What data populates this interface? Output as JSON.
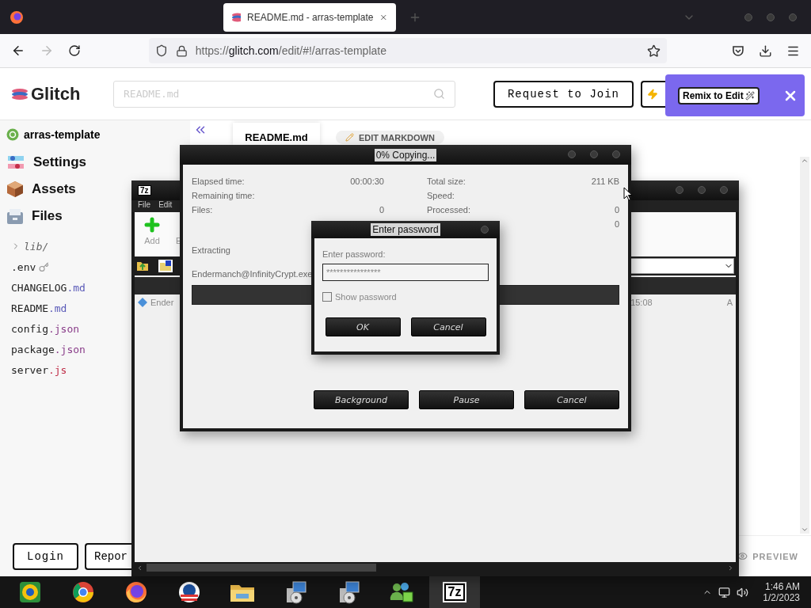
{
  "browser": {
    "tabs": [
      {
        "title": "README.md - arras-template",
        "selected": true
      }
    ],
    "url": {
      "scheme": "https://",
      "host": "glitch.com",
      "path": "/edit/#!/arras-template"
    }
  },
  "glitch": {
    "logo": "Glitch",
    "search": {
      "placeholder": "README.md"
    },
    "request_button": "Request to Join",
    "remix_button": "Remix to Edit"
  },
  "sidebar": {
    "project": "arras-template",
    "sections": [
      {
        "label": "Settings",
        "kind": "settings"
      },
      {
        "label": "Assets",
        "kind": "assets"
      },
      {
        "label": "Files",
        "kind": "files"
      }
    ],
    "files": [
      {
        "kind": "folder",
        "base": "lib/",
        "expanded": false
      },
      {
        "kind": "secret",
        "base": ".env"
      },
      {
        "kind": "file",
        "base": "CHANGELOG",
        "ext": ".md",
        "color": "#5a5ab8"
      },
      {
        "kind": "file",
        "base": "README",
        "ext": ".md",
        "color": "#5a5ab8"
      },
      {
        "kind": "file",
        "base": "config",
        "ext": ".json",
        "color": "#8a3e8a"
      },
      {
        "kind": "file",
        "base": "package",
        "ext": ".json",
        "color": "#8a3e8a"
      },
      {
        "kind": "file",
        "base": "server",
        "ext": ".js",
        "color": "#c0304a"
      }
    ],
    "footer": [
      "Login",
      "Repor"
    ]
  },
  "editor": {
    "tab": "README.md",
    "edit_button": "EDIT MARKDOWN",
    "preview": "PREVIEW"
  },
  "sevenzip": {
    "icon": "7z",
    "menu": [
      "File",
      "Edit"
    ],
    "toolbar": [
      "Add",
      "E"
    ],
    "row": [
      "Ender",
      "15:08",
      "A"
    ]
  },
  "copying": {
    "title": "0% Copying...",
    "stats_left": [
      {
        "label": "Elapsed time:",
        "value": "00:00:30"
      },
      {
        "label": "Remaining time:"
      },
      {
        "label": "Files:",
        "value": "0"
      }
    ],
    "stats_right": [
      {
        "label": "Total size:",
        "value": "211 KB"
      },
      {
        "label": "Speed:"
      },
      {
        "label": "Processed:",
        "value": "0"
      },
      {
        "value": "0"
      }
    ],
    "action": "Extracting",
    "file": "Endermanch@InfinityCrypt.exe",
    "progress": {
      "level": 0
    },
    "buttons": [
      "Background",
      "Pause",
      "Cancel"
    ]
  },
  "password": {
    "title": "Enter password",
    "label": "Enter password:",
    "value": "****************",
    "show_password": {
      "label": "Show password",
      "checked": false
    },
    "buttons": [
      "OK",
      "Cancel"
    ]
  },
  "taskbar": {
    "apps": [
      {
        "kind": "ring-dark"
      },
      {
        "kind": "ring"
      },
      {
        "kind": "fox"
      },
      {
        "kind": "badge"
      },
      {
        "kind": "folder"
      },
      {
        "kind": "installer"
      },
      {
        "kind": "installer"
      },
      {
        "kind": "people"
      },
      {
        "kind": "text",
        "label": "7z",
        "selected": true
      }
    ],
    "time": "1:46 AM",
    "date": "1/2/2023"
  }
}
